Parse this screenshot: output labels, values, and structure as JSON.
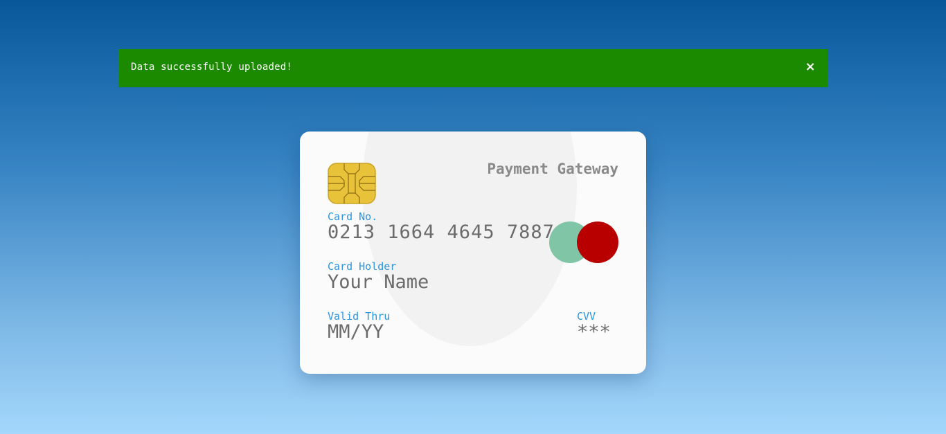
{
  "alert": {
    "message": "Data successfully uploaded!",
    "close_symbol": "×",
    "background": "#1c8a00"
  },
  "card": {
    "brand": "Payment Gateway",
    "chip_icon": "chip-icon",
    "card_number_label": "Card No.",
    "card_number": "0213 1664 4645 7887",
    "card_holder_label": "Card Holder",
    "card_holder": "Your Name",
    "valid_thru_label": "Valid Thru",
    "valid_thru": "MM/YY",
    "cvv_label": "CVV",
    "cvv": "***",
    "logo_colors": [
      "#80c5a6",
      "#b80000"
    ],
    "label_color": "#2a94dd"
  }
}
